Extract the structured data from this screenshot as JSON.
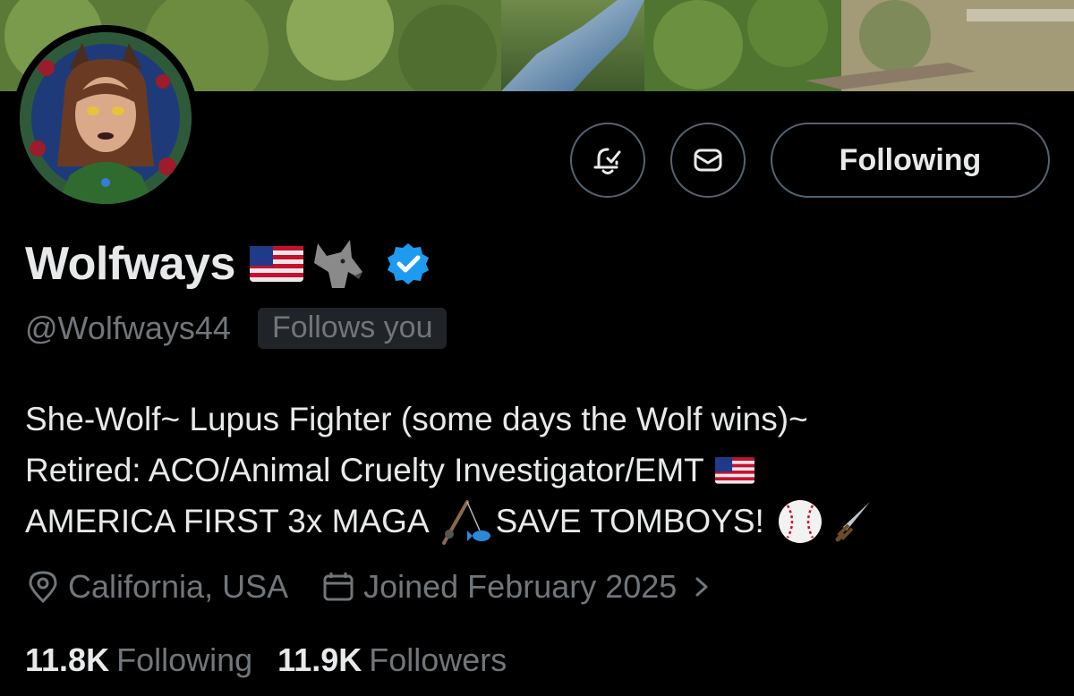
{
  "colors": {
    "background": "#000000",
    "primary_text": "#e7e9ea",
    "secondary_text": "#71767b",
    "border": "#536471",
    "verified_blue": "#1d9bf0",
    "badge_bg": "#202327"
  },
  "banner": {
    "icon": "nature-photo"
  },
  "avatar": {
    "icon": "wolf-girl-avatar"
  },
  "actions": {
    "notify_icon": "bell-check-icon",
    "message_icon": "envelope-icon",
    "following_label": "Following"
  },
  "profile": {
    "display_name": "Wolfways",
    "name_emojis": [
      "us-flag-icon",
      "wolf-icon"
    ],
    "verified_icon": "verified-badge-icon",
    "handle": "@Wolfways44",
    "follows_you_label": "Follows you"
  },
  "bio": {
    "line1": "She-Wolf~ Lupus Fighter (some days the Wolf wins)~",
    "line2": "Retired: ACO/Animal Cruelty Investigator/EMT",
    "line3_a": "AMERICA FIRST 3x MAGA",
    "line3_b": "SAVE TOMBOYS!",
    "emojis": [
      "us-flag-icon",
      "fishing-pole-icon",
      "baseball-icon",
      "dagger-icon"
    ]
  },
  "meta": {
    "location_icon": "location-pin-icon",
    "location": "California, USA",
    "joined_icon": "calendar-icon",
    "joined": "Joined February 2025",
    "chevron_icon": "chevron-right-icon"
  },
  "stats": {
    "following_count": "11.8K",
    "following_label": "Following",
    "followers_count": "11.9K",
    "followers_label": "Followers"
  }
}
